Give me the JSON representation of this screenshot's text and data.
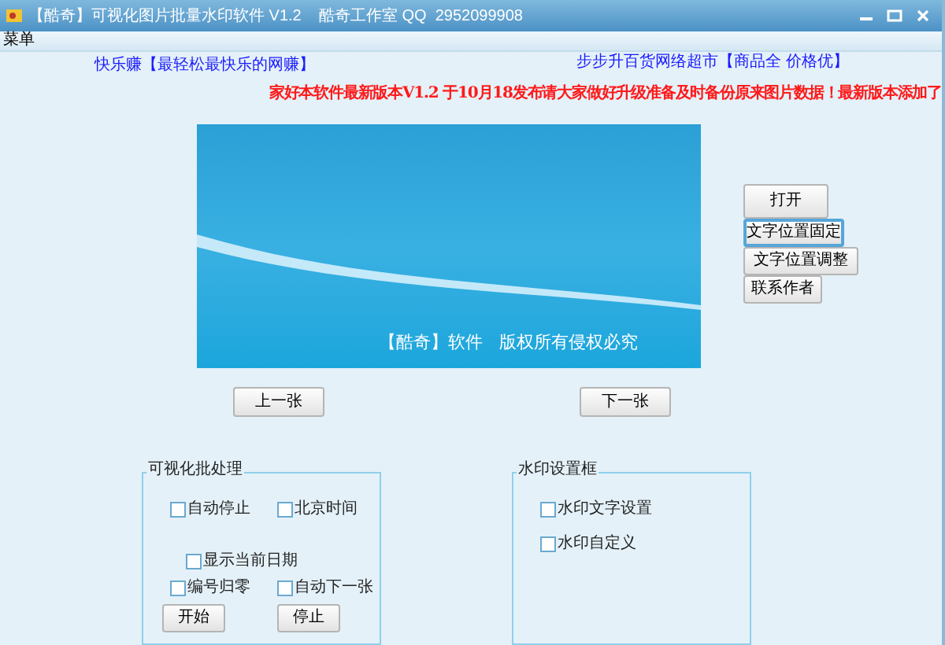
{
  "window": {
    "title": "【酷奇】可视化图片批量水印软件 V1.2    酷奇工作室 QQ  2952099908"
  },
  "menu": [
    "菜单"
  ],
  "links": [
    {
      "text": "快乐赚【最轻松最快乐的网赚】"
    },
    {
      "text": "步步升百货网络超市【商品全  价格优】"
    }
  ],
  "notice": "家好本软件最新版本V1.2 于10月18发布请大家做好升级准备及时备份原来图片数据！最新版本添加了",
  "preview": {
    "caption": "【酷奇】软件   版权所有侵权必究"
  },
  "side_buttons": [
    {
      "label": "打开",
      "focused": false
    },
    {
      "label": "文字位置固定",
      "focused": true
    },
    {
      "label": "文字位置调整",
      "focused": false
    },
    {
      "label": "联系作者",
      "focused": false
    }
  ],
  "nav_buttons": [
    "上一张",
    "下一张"
  ],
  "batch_group": {
    "title": "可视化批处理",
    "checkboxes": [
      {
        "label": "自动停止",
        "checked": false
      },
      {
        "label": "北京时间",
        "checked": false
      },
      {
        "label": "显示当前日期",
        "checked": false
      },
      {
        "label": "编号归零",
        "checked": false
      },
      {
        "label": "自动下一张",
        "checked": false
      }
    ],
    "buttons": [
      "开始",
      "停止"
    ]
  },
  "watermark_group": {
    "title": "水印设置框",
    "checkboxes": [
      {
        "label": "水印文字设置",
        "checked": false
      },
      {
        "label": "水印自定义",
        "checked": false
      }
    ]
  }
}
